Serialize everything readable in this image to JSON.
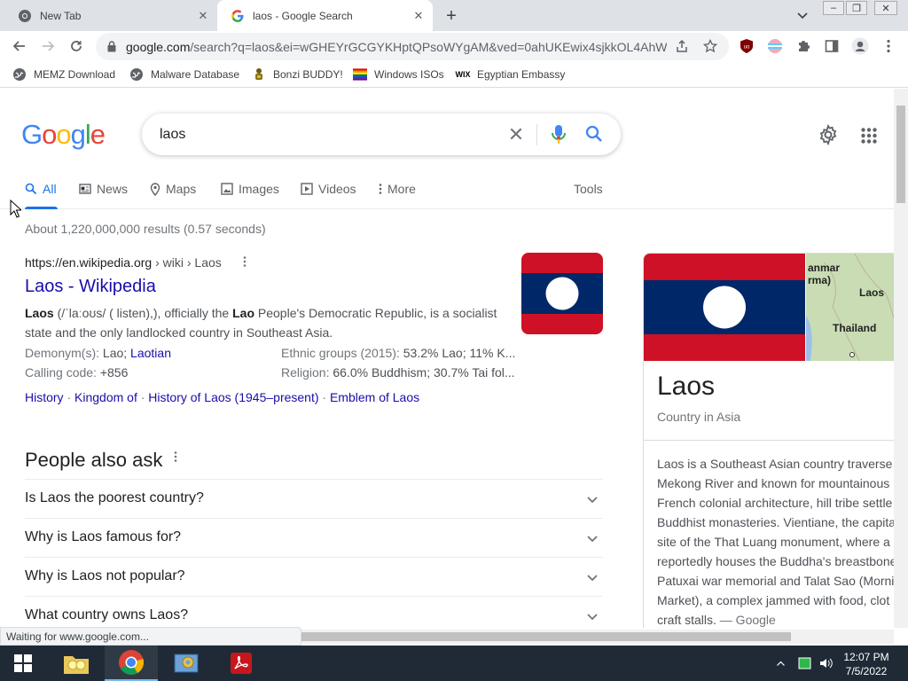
{
  "browser": {
    "tabs": [
      {
        "title": "New Tab",
        "active": false
      },
      {
        "title": "laos - Google Search",
        "active": true
      }
    ],
    "url": {
      "host": "google.com",
      "rest": "/search?q=laos&ei=wGHEYrGCGYKHptQPsoWYgAM&ved=0ahUKEwix4sjkkOL4AhW..."
    },
    "bookmarks": [
      {
        "label": "MEMZ Download",
        "icon": "globe-icon"
      },
      {
        "label": "Malware Database",
        "icon": "globe-icon"
      },
      {
        "label": "Bonzi BUDDY!",
        "icon": "bonzi-icon"
      },
      {
        "label": "Windows ISOs",
        "icon": "rainbow-flag-icon"
      },
      {
        "label": "Egyptian Embassy",
        "icon": "wix-icon"
      }
    ],
    "status_text": "Waiting for www.google.com..."
  },
  "google": {
    "logo_letters": [
      "G",
      "o",
      "o",
      "g",
      "l",
      "e"
    ],
    "logo_colors": [
      "#4285f4",
      "#ea4335",
      "#fbbc05",
      "#4285f4",
      "#34a853",
      "#ea4335"
    ],
    "query": "laos",
    "tabs": [
      "All",
      "News",
      "Maps",
      "Images",
      "Videos",
      "More"
    ],
    "tools_label": "Tools",
    "result_stats": "About 1,220,000,000 results (0.57 seconds)",
    "wiki": {
      "cite_host": "https://en.wikipedia.org",
      "cite_path": " › wiki › Laos",
      "title": "Laos - Wikipedia",
      "snippet_b1": "Laos",
      "snippet_1": " (/ˈlaːoʊs/ ( listen),), officially the ",
      "snippet_b2": "Lao",
      "snippet_2": " People's Democratic Republic, is a socialist state and the only landlocked country in Southeast Asia.",
      "demonym_label": "Demonym(s): ",
      "demonym_value": "Lao; ",
      "demonym_link": "Laotian",
      "ethnic_label": "Ethnic groups (2015): ",
      "ethnic_value": "53.2% Lao; 11% K...",
      "calling_label": "Calling code: ",
      "calling_value": "+856",
      "religion_label": "Religion: ",
      "religion_value": "66.0% Buddhism; 30.7% Tai fol...",
      "sitelinks": [
        "History",
        "Kingdom of",
        "History of Laos (1945–present)",
        "Emblem of Laos"
      ],
      "sitelink_sep": " · "
    },
    "paa": {
      "heading": "People also ask",
      "questions": [
        "Is Laos the poorest country?",
        "Why is Laos famous for?",
        "Why is Laos not popular?",
        "What country owns Laos?"
      ]
    },
    "knowledge_panel": {
      "title": "Laos",
      "subtitle": "Country in Asia",
      "map_labels": [
        "anmar",
        "rma)",
        "Laos",
        "Thailand"
      ],
      "description_lines": [
        "Laos is a Southeast Asian country traverse",
        "Mekong River and known for mountainous",
        "French colonial architecture, hill tribe settle",
        "Buddhist monasteries. Vientiane, the capita",
        "site of the That Luang monument, where a",
        "reportedly houses the Buddha's breastbone",
        "Patuxai war memorial and Talat Sao (Morni",
        "Market), a complex jammed with food, clot",
        "craft stalls."
      ],
      "source": " — Google"
    },
    "flag_colors": {
      "red": "#ce1126",
      "blue": "#002868",
      "white": "#ffffff"
    }
  },
  "taskbar": {
    "time": "12:07 PM",
    "date": "7/5/2022"
  }
}
